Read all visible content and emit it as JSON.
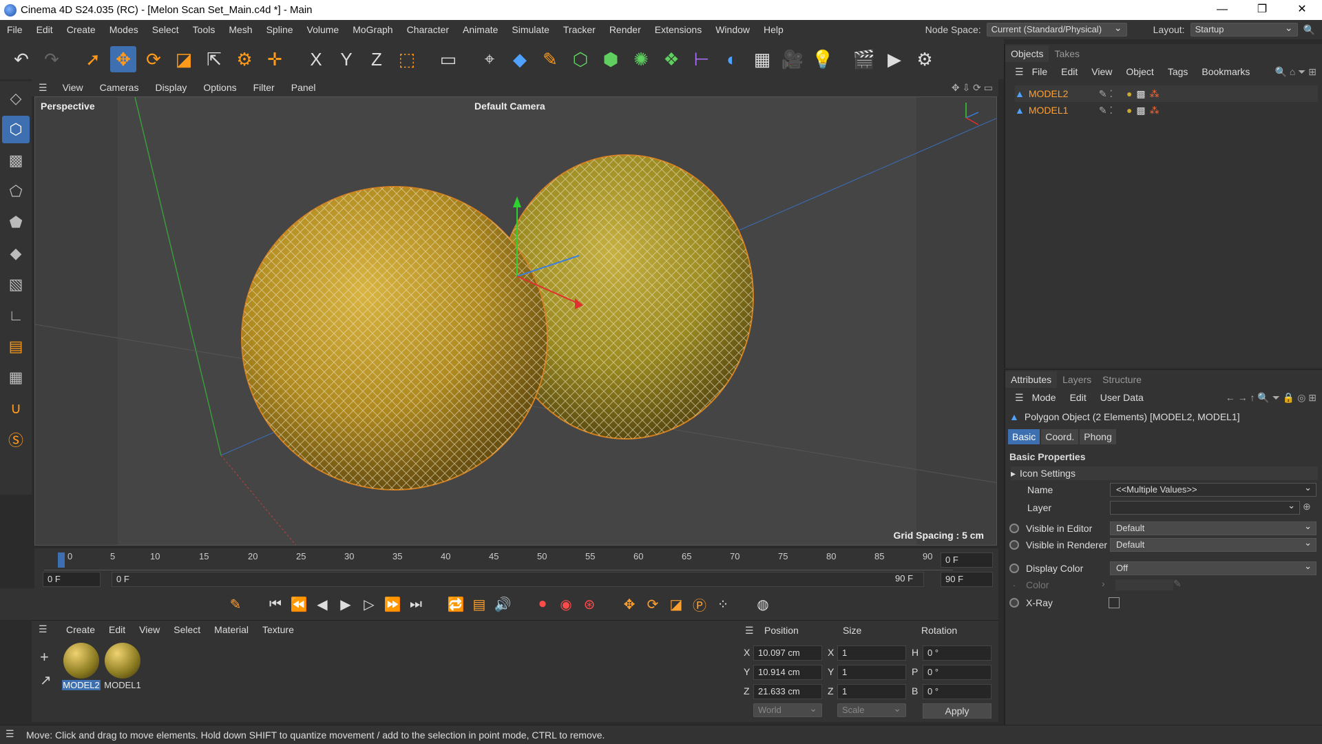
{
  "window": {
    "title": "Cinema 4D S24.035 (RC) - [Melon Scan Set_Main.c4d *] - Main",
    "min": "—",
    "max": "❐",
    "close": "✕"
  },
  "menu": [
    "File",
    "Edit",
    "Create",
    "Modes",
    "Select",
    "Tools",
    "Mesh",
    "Spline",
    "Volume",
    "MoGraph",
    "Character",
    "Animate",
    "Simulate",
    "Tracker",
    "Render",
    "Extensions",
    "Window",
    "Help"
  ],
  "node_space": {
    "label": "Node Space:",
    "value": "Current (Standard/Physical)"
  },
  "layout": {
    "label": "Layout:",
    "value": "Startup"
  },
  "viewport": {
    "menu": [
      "View",
      "Cameras",
      "Display",
      "Options",
      "Filter",
      "Panel"
    ],
    "label": "Perspective",
    "camera": "Default Camera",
    "grid_spacing": "Grid Spacing : 5 cm"
  },
  "timeline": {
    "ticks": [
      "0",
      "5",
      "10",
      "15",
      "20",
      "25",
      "30",
      "35",
      "40",
      "45",
      "50",
      "55",
      "60",
      "65",
      "70",
      "75",
      "80",
      "85",
      "90"
    ],
    "current_frame": "0 F",
    "start": "0 F",
    "start_inner": "0 F",
    "end_inner": "90 F",
    "end": "90 F"
  },
  "material_manager": {
    "menu": [
      "Create",
      "Edit",
      "View",
      "Select",
      "Material",
      "Texture"
    ],
    "materials": [
      "MODEL2",
      "MODEL1"
    ]
  },
  "coordinates": {
    "headers": [
      "Position",
      "Size",
      "Rotation"
    ],
    "rows": [
      {
        "axis": "X",
        "pos": "10.097 cm",
        "size_axis": "X",
        "size": "1",
        "rot_axis": "H",
        "rot": "0 °"
      },
      {
        "axis": "Y",
        "pos": "10.914 cm",
        "size_axis": "Y",
        "size": "1",
        "rot_axis": "P",
        "rot": "0 °"
      },
      {
        "axis": "Z",
        "pos": "21.633 cm",
        "size_axis": "Z",
        "size": "1",
        "rot_axis": "B",
        "rot": "0 °"
      }
    ],
    "space": "World",
    "mode": "Scale",
    "apply": "Apply"
  },
  "objects_panel": {
    "tabs": [
      "Objects",
      "Takes"
    ],
    "menu": [
      "File",
      "Edit",
      "View",
      "Object",
      "Tags",
      "Bookmarks"
    ],
    "items": [
      "MODEL2",
      "MODEL1"
    ]
  },
  "attributes_panel": {
    "tabs": [
      "Attributes",
      "Layers",
      "Structure"
    ],
    "menu": [
      "Mode",
      "Edit",
      "User Data"
    ],
    "object_info": "Polygon Object (2 Elements) [MODEL2, MODEL1]",
    "subtabs": [
      "Basic",
      "Coord.",
      "Phong"
    ],
    "section": "Basic Properties",
    "icon_settings": "Icon Settings",
    "name_label": "Name",
    "name_value": "<<Multiple Values>>",
    "layer_label": "Layer",
    "visible_editor_label": "Visible in Editor",
    "visible_editor_value": "Default",
    "visible_renderer_label": "Visible in Renderer",
    "visible_renderer_value": "Default",
    "display_color_label": "Display Color",
    "display_color_value": "Off",
    "color_label": "Color",
    "xray_label": "X-Ray"
  },
  "status": "Move: Click and drag to move elements. Hold down SHIFT to quantize movement / add to the selection in point mode, CTRL to remove."
}
